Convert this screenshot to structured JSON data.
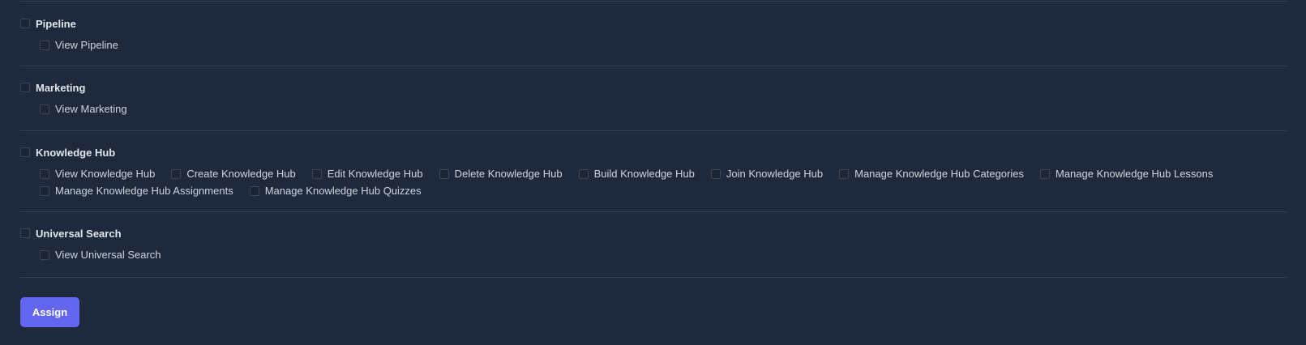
{
  "groups": [
    {
      "title": "Pipeline",
      "permissions": [
        "View Pipeline"
      ]
    },
    {
      "title": "Marketing",
      "permissions": [
        "View Marketing"
      ]
    },
    {
      "title": "Knowledge Hub",
      "permissions": [
        "View Knowledge Hub",
        "Create Knowledge Hub",
        "Edit Knowledge Hub",
        "Delete Knowledge Hub",
        "Build Knowledge Hub",
        "Join Knowledge Hub",
        "Manage Knowledge Hub Categories",
        "Manage Knowledge Hub Lessons",
        "Manage Knowledge Hub Assignments",
        "Manage Knowledge Hub Quizzes"
      ]
    },
    {
      "title": "Universal Search",
      "permissions": [
        "View Universal Search"
      ]
    }
  ],
  "actions": {
    "assign_label": "Assign"
  },
  "colors": {
    "background": "#1e293b",
    "divider": "#334155",
    "accent": "#6366f1"
  }
}
